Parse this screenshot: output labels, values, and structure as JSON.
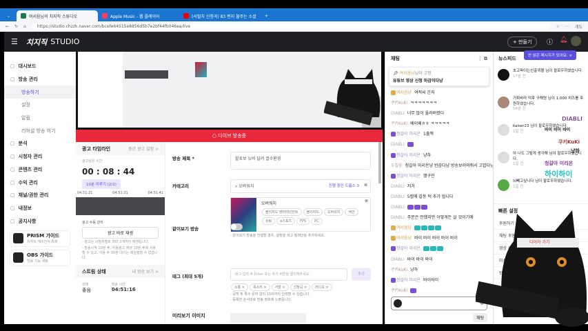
{
  "browser": {
    "tabs": [
      {
        "label": "여서음님의 치지직 스튜디오",
        "active": true
      },
      {
        "label": "Apple Music - 웹 플레이어"
      },
      {
        "label": "(서벌치 신청곡) 83 편지 불주는 소셜"
      }
    ],
    "url": "https://studio.chzzk.naver.com/bcefe64515e8856d5b7e2bf44fb046ea/live",
    "profile_label": "개도"
  },
  "header": {
    "brand": "치지직",
    "studio": "STUDIO",
    "make_button": "+ 만들기"
  },
  "sidebar": {
    "items": [
      {
        "label": "대시보드",
        "icon": "dashboard-icon"
      },
      {
        "label": "방송 관리",
        "icon": "broadcast-icon"
      },
      {
        "label": "방송하기",
        "sub": true,
        "selected": true
      },
      {
        "label": "설정",
        "sub": true
      },
      {
        "label": "알림",
        "sub": true
      },
      {
        "label": "리허설 방송 하기",
        "sub": true
      },
      {
        "label": "분석",
        "icon": "chart-icon"
      },
      {
        "label": "시청자 관리",
        "icon": "users-icon"
      },
      {
        "label": "콘텐츠 관리",
        "icon": "content-icon"
      },
      {
        "label": "수익 관리",
        "icon": "money-icon"
      },
      {
        "label": "채널/권한 관리",
        "icon": "permission-icon"
      },
      {
        "label": "내정보",
        "icon": "person-icon"
      },
      {
        "label": "공지사항",
        "icon": "megaphone-icon"
      }
    ],
    "guides": [
      {
        "title": "PRISM 가이드",
        "subtitle": "치지직 캐리인서 특화"
      },
      {
        "title": "OBS 가이드",
        "subtitle": "방송 기능 세팅"
      }
    ]
  },
  "live_bar": "다이브 방송중",
  "ad": {
    "title": "광고 타임라인",
    "link": "중간 광고 설정 >",
    "remaining_label": "광고남은 시간",
    "timer": "00 : 08 : 44",
    "delay_button": "10분 미루기 (2/2)",
    "ticks": [
      "04:51:21",
      "04:51:31",
      "04:51:41"
    ],
    "manage_label": "광고 수동 관리",
    "play_button": "광고 바로 재생",
    "notes": [
      "- 광고는 시청자별로 최대 2개까지 재생됩니다.",
      "- 방송시작 10분 후, 자동광고 재생 10분 후에 사용할 수 있고, 사용 후 30분 대기는 재실행할 수 없습니다."
    ]
  },
  "stream": {
    "title": "스트림 상태",
    "link": "내 방송 보기 >",
    "state_label": "상태",
    "state": "좋음",
    "time_label": "방송 시간",
    "time": "04:51:16"
  },
  "form": {
    "title_label": "방송 제목 *",
    "title_value": "왈초보 뉴비 달려 꿀수환영",
    "category_label": "카테고리",
    "category_value": "오버워치",
    "category_badge": "진행 중인 드롭스 3",
    "game_name": "오버워치",
    "game_chips": [
      "블리자드 엔터테인먼트",
      "블리자드",
      "오버워치",
      "액션",
      "슈팅",
      "e스포츠",
      "FPS",
      "PC"
    ],
    "together_label": "같이보기 방송",
    "together_note": "- 같이보기 방송을 진행할 경우, 설정을 켜고 정책안을 추가하세요.",
    "tag_label": "태그 (최대 5개)",
    "tag_placeholder": "태그 입력 후 Enter 또는 추가 버튼을 클릭해주세요.",
    "tag_add": "추가",
    "tags": [
      "소통 ×",
      "목소리 ×",
      "서벌 ×",
      "신청곡 ×",
      "라디오 ×"
    ],
    "tag_notes": [
      "- 공백 및 특수 문자 없이 15자까지 입력할 수 있습니다.",
      "- 등록한 순서대로 방송 정보에 노출됩니다."
    ],
    "thumb_label": "미리보기 이미지"
  },
  "chat": {
    "title": "채팅",
    "pinned_user": "여서음님",
    "pinned_suffix": "님이 고정",
    "pinned_text": "유튜브 영상 신청 마감이다냥",
    "messages": [
      {
        "nick": "여서음냥",
        "text": "여적씨 간지",
        "c": "o"
      },
      {
        "nick": "쿠키KuKi",
        "text": "ㅋㅋㅋㅋㅋㅋㅋ",
        "c": ""
      },
      {
        "nick": "DIABLI",
        "text": "너무 많이 올라버렸다",
        "c": "d"
      },
      {
        "nick": "쿠키KuKi",
        "text": "베이베ㅎㅎ ㅋㅋㅋㅋㅋ",
        "c": ""
      },
      {
        "nick": "청갈아 미리온",
        "text": "1출첵",
        "c": "p"
      },
      {
        "nick": "DIABLI",
        "text": "",
        "c": "d",
        "emo": 1
      },
      {
        "nick": "청갈아 미리온",
        "text": "냥하",
        "c": "p"
      },
      {
        "nick": "두칠웅",
        "text": "청갈아 미리온냥 반갑다냥 방송보러와줘서 고맙다냥",
        "c": ""
      },
      {
        "nick": "청갈아 미리온",
        "text": "했구만",
        "c": "p"
      },
      {
        "nick": "DIABLI",
        "text": "저거",
        "c": "d"
      },
      {
        "nick": "DIABLI",
        "text": "5렙에 갈동 턱 추가 됩니다",
        "c": "d"
      },
      {
        "nick": "DIABLI",
        "text": "",
        "c": "d",
        "emo": 3
      },
      {
        "nick": "DIABLI",
        "text": "주문은 안했지만 어떻게든 살 것이기에",
        "c": "d"
      },
      {
        "nick": "여서음냥",
        "text": "",
        "c": "o",
        "emo": 4
      },
      {
        "nick": "여서음냥",
        "text": "바이 바이 바이 바이 바이",
        "c": "o"
      },
      {
        "nick": "청갈아 미리온",
        "text": "",
        "c": "p",
        "emo": 3
      },
      {
        "nick": "DIABLI",
        "text": "바이 바이 바이",
        "c": "d"
      },
      {
        "nick": "쿠키KuKi",
        "text": "냥하",
        "c": ""
      },
      {
        "nick": "청갈아 미리온",
        "text": "바이바이",
        "c": "p"
      },
      {
        "nick": "쿠키KuKi",
        "text": "",
        "c": "",
        "emo": 1
      }
    ],
    "send": "채팅"
  },
  "right": {
    "tooltip": "안 읽은 메시지가 있어요.",
    "news_title": "뉴스피드",
    "news": [
      {
        "text": "초고파이는신출귀몰 님이 팔로우하였습니다.",
        "time": "17분 전"
      },
      {
        "text": "거피바라 덕후 구해령 님이 1,000 치즈를 후원하였습니다.",
        "time": "54분 전"
      },
      {
        "text": "kaiser23 님이 팔로우하였습니다.",
        "time": "1일 전"
      },
      {
        "text": "아 나도 그렇게 생각해 님이 팔로우하였습니다.",
        "time": "1일 전"
      },
      {
        "text": "뇌빼고싶니다 님이 팔로우하였습니다.",
        "time": "1일 전"
      }
    ],
    "quick_title": "빠른 설정",
    "quick_items": [
      "후원하기",
      "채팅 후원",
      "영상 후원",
      "미션 후원",
      "방송 설정",
      "",
      "이모티콘 모드"
    ]
  },
  "overlay": {
    "headband": "다이아 가기",
    "stickers": [
      "DIABLI",
      "바이 바이 바이",
      "쿠키KuKi",
      "냥하",
      "청갈아 미리온",
      "하이하이"
    ]
  },
  "colors": {
    "accent": "#5b4fe0",
    "live": "#e8283c",
    "tabbar": "#1b74d0"
  }
}
